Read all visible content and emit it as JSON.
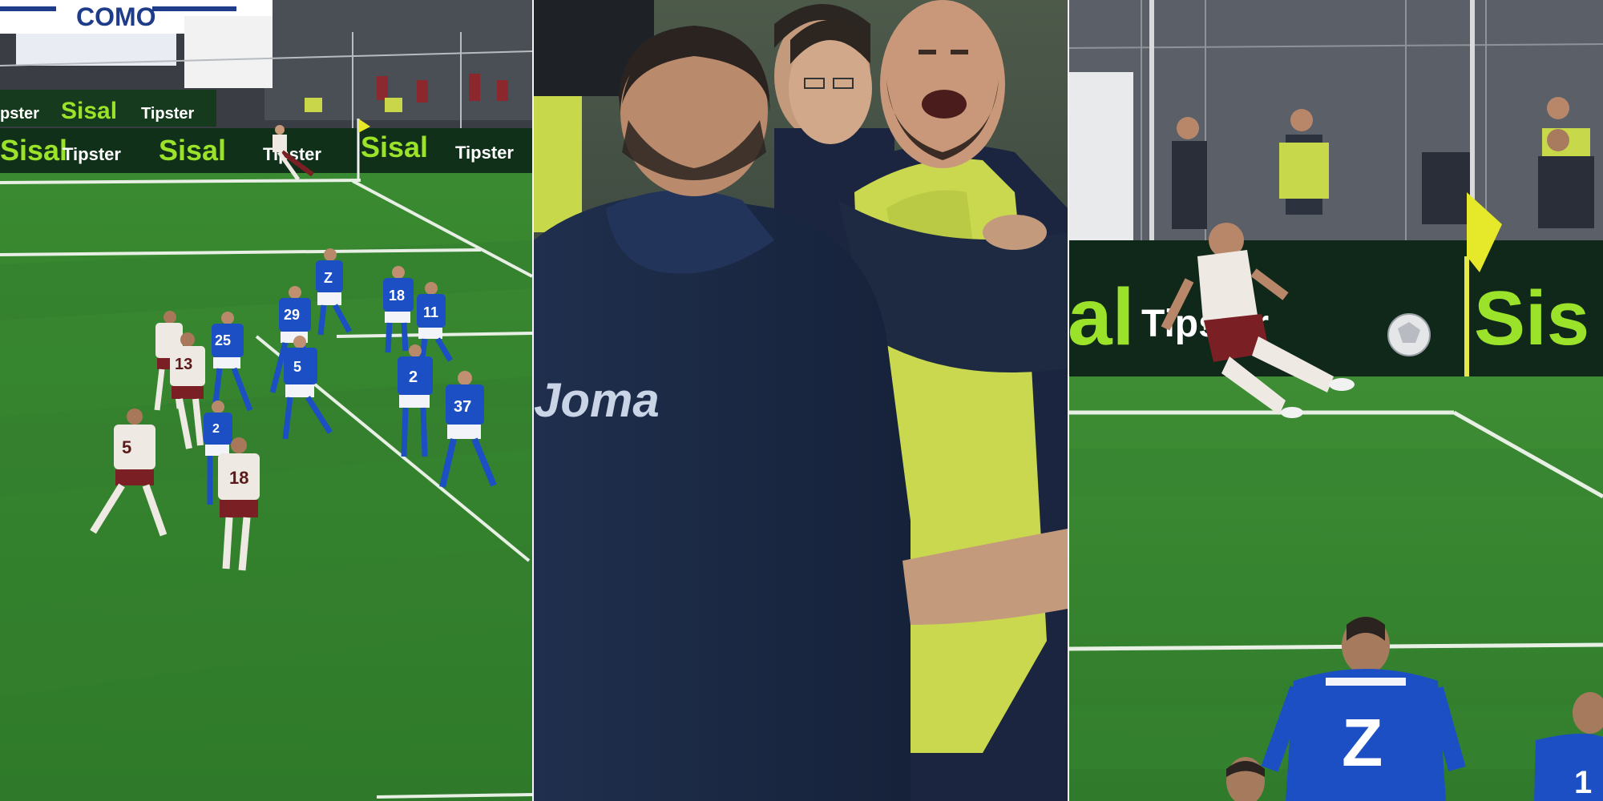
{
  "panels": {
    "left": {
      "stadium_sign": "COMO",
      "ad_boards": [
        {
          "brand": "Sisal",
          "tag": "Tipster"
        },
        {
          "brand": "Sisal",
          "tag": "Tipster"
        },
        {
          "brand": "Sisal",
          "tag": "Tipster"
        }
      ],
      "upper_ad": {
        "tag_left": "pster",
        "brand": "Sisal",
        "tag": "Tipster"
      },
      "blue_numbers": [
        "Z",
        "18",
        "25",
        "29",
        "11",
        "5",
        "2",
        "37",
        "2"
      ],
      "white_numbers": [
        "13",
        "5",
        "18"
      ]
    },
    "middle": {
      "jacket_brand": "Joma"
    },
    "right": {
      "ad_left": "al",
      "ad_mid": "Tipster",
      "ad_right": "Sis",
      "defender_number": "Z",
      "edge_number": "1"
    }
  },
  "colors": {
    "pitch_dark": "#2f7a2c",
    "pitch_light": "#3b8c33",
    "sisal_green": "#9be22a",
    "como_blue": "#1d4fc4",
    "away_white": "#efe9e4",
    "away_maroon": "#7a1f24",
    "hivis_yellow": "#c7d84a",
    "navy_jacket": "#1b2a45"
  }
}
